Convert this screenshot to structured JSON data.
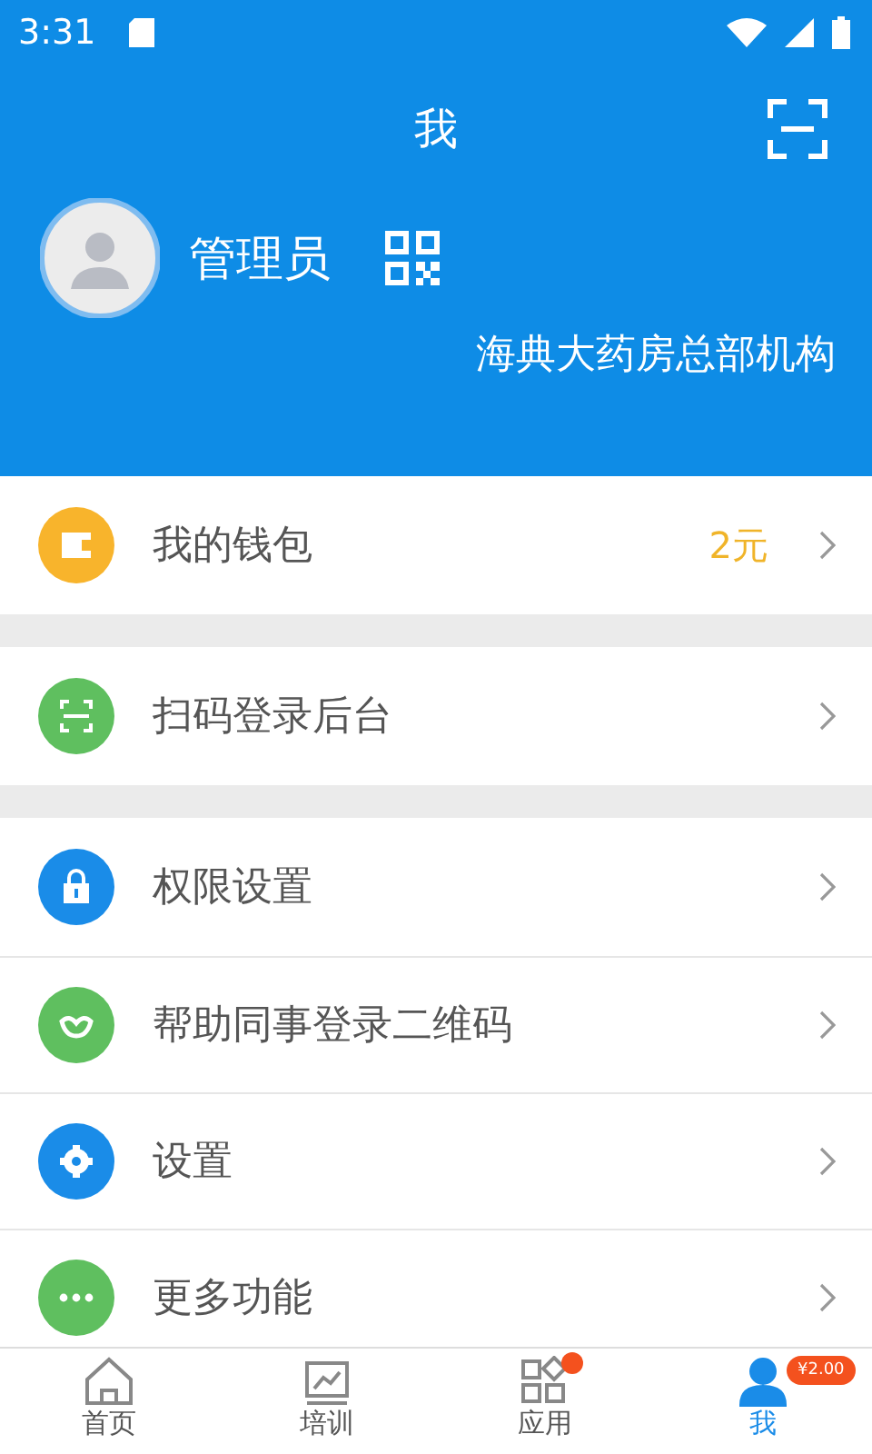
{
  "status_bar": {
    "time": "3:31"
  },
  "header": {
    "title": "我"
  },
  "profile": {
    "name": "管理员",
    "organization": "海典大药房总部机构"
  },
  "sections": [
    {
      "items": [
        {
          "kind": "wallet",
          "color": "#f8b42c",
          "label": "我的钱包",
          "value": "2元"
        }
      ]
    },
    {
      "items": [
        {
          "kind": "scan",
          "color": "#5fbf5f",
          "label": "扫码登录后台"
        }
      ]
    },
    {
      "items": [
        {
          "kind": "lock",
          "color": "#1a8ce8",
          "label": "权限设置"
        },
        {
          "kind": "heart",
          "color": "#5fbf5f",
          "label": "帮助同事登录二维码"
        },
        {
          "kind": "gear",
          "color": "#1a8ce8",
          "label": "设置"
        },
        {
          "kind": "more",
          "color": "#5fbf5f",
          "label": "更多功能"
        }
      ]
    }
  ],
  "bottom_nav": [
    {
      "kind": "home",
      "label": "首页",
      "selected": false,
      "dot": false
    },
    {
      "kind": "training",
      "label": "培训",
      "selected": false,
      "dot": false
    },
    {
      "kind": "apps",
      "label": "应用",
      "selected": false,
      "dot": true
    },
    {
      "kind": "me",
      "label": "我",
      "selected": true,
      "dot": false,
      "badge": "¥2.00"
    }
  ]
}
